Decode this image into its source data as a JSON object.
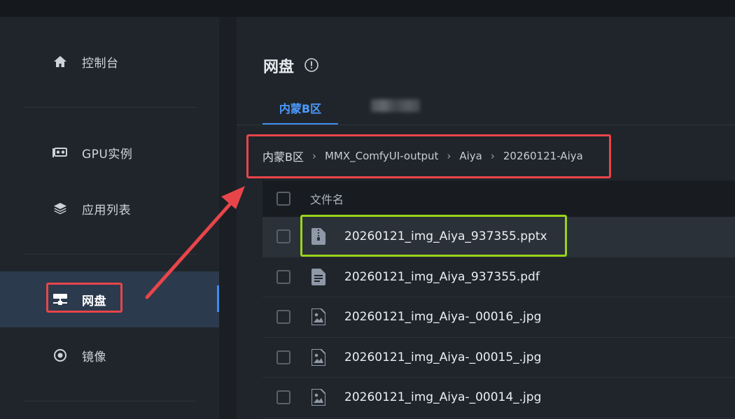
{
  "sidebar": {
    "items": [
      {
        "label": "控制台",
        "icon": "home-icon"
      },
      {
        "label": "GPU实例",
        "icon": "gpu-icon"
      },
      {
        "label": "应用列表",
        "icon": "layers-icon"
      },
      {
        "label": "网盘",
        "icon": "network-drive-icon",
        "active": true
      },
      {
        "label": "镜像",
        "icon": "radio-target-icon"
      }
    ]
  },
  "main": {
    "title": "网盘",
    "tabs": [
      {
        "label": "内蒙B区",
        "active": true
      },
      {
        "label": "",
        "blurred": true
      }
    ],
    "breadcrumb": [
      "内蒙B区",
      "MMX_ComfyUI-output",
      "Aiya",
      "20260121-Aiya"
    ],
    "table": {
      "header": "文件名",
      "rows": [
        {
          "name": "20260121_img_Aiya_937355.pptx",
          "type": "zip"
        },
        {
          "name": "20260121_img_Aiya_937355.pdf",
          "type": "document"
        },
        {
          "name": "20260121_img_Aiya-_00016_.jpg",
          "type": "image"
        },
        {
          "name": "20260121_img_Aiya-_00015_.jpg",
          "type": "image"
        },
        {
          "name": "20260121_img_Aiya-_00014_.jpg",
          "type": "image"
        }
      ]
    }
  },
  "colors": {
    "accent": "#3d8cf0",
    "annotation_red": "#e8454a",
    "annotation_green": "#9ad41a"
  }
}
